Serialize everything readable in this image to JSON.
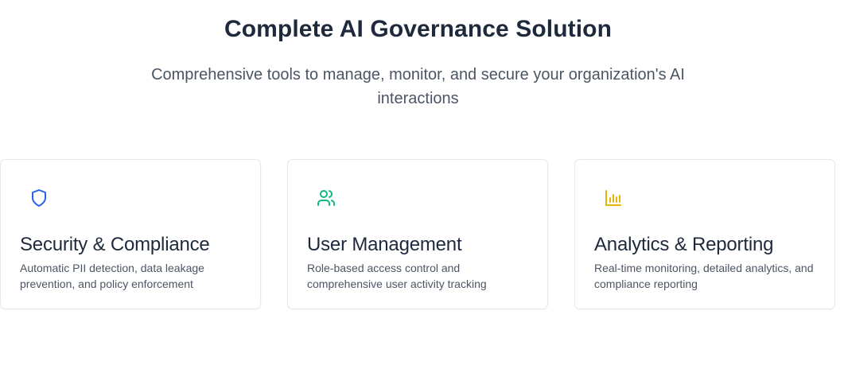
{
  "section": {
    "title": "Complete AI Governance Solution",
    "subtitle": "Comprehensive tools to manage, monitor, and secure your organization's AI interactions"
  },
  "features": [
    {
      "icon": "shield-icon",
      "icon_color": "#2563eb",
      "title": "Security & Compliance",
      "description": "Automatic PII detection, data leakage prevention, and policy enforcement"
    },
    {
      "icon": "users-icon",
      "icon_color": "#10b981",
      "title": "User Management",
      "description": "Role-based access control and comprehensive user activity tracking"
    },
    {
      "icon": "bar-chart-icon",
      "icon_color": "#eab308",
      "title": "Analytics & Reporting",
      "description": "Real-time monitoring, detailed analytics, and compliance reporting"
    }
  ]
}
